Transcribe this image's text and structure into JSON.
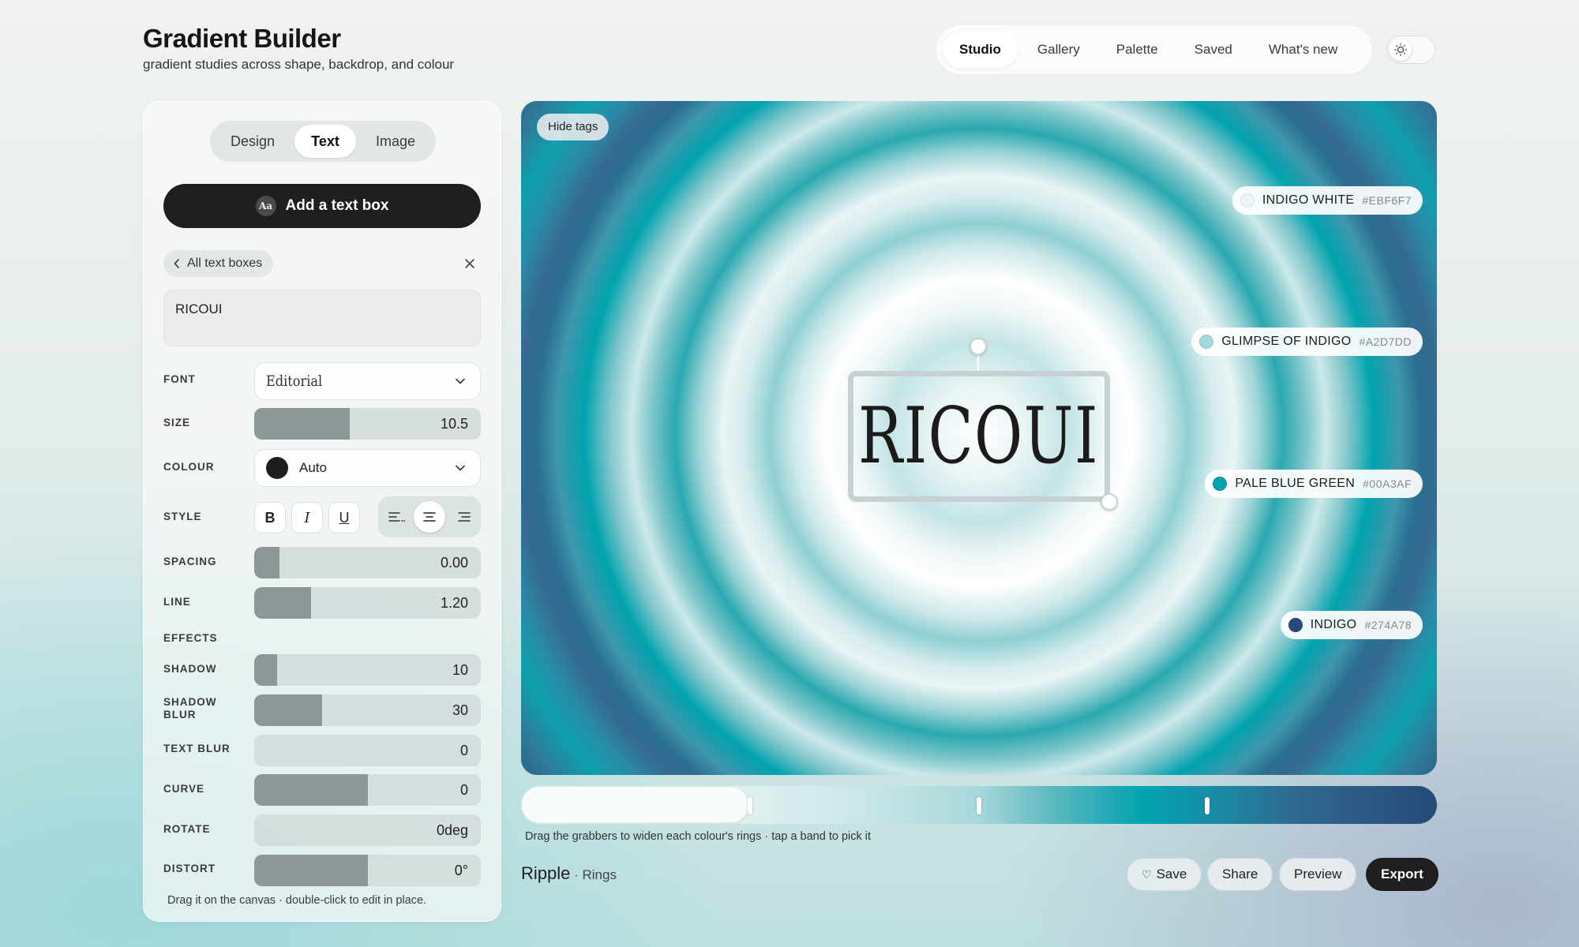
{
  "app": {
    "title": "Gradient Builder",
    "subtitle": "gradient studies across shape, backdrop, and colour"
  },
  "nav": {
    "tabs": [
      "Studio",
      "Gallery",
      "Palette",
      "Saved",
      "What's new"
    ],
    "active": "Studio"
  },
  "panel": {
    "tabs": [
      "Design",
      "Text",
      "Image"
    ],
    "active_tab": "Text",
    "add_button": "Add a text box",
    "add_icon_text": "Aa",
    "back_label": "All text boxes",
    "text_value": "RICOUI",
    "labels": {
      "font": "FONT",
      "size": "SIZE",
      "colour": "COLOUR",
      "style": "STYLE",
      "spacing": "SPACING",
      "line": "LINE",
      "effects": "EFFECTS",
      "shadow": "SHADOW",
      "shadow_blur": "SHADOW BLUR",
      "text_blur": "TEXT BLUR",
      "curve": "CURVE",
      "rotate": "ROTATE",
      "distort": "DISTORT"
    },
    "font_value": "Editorial",
    "colour_value": "Auto",
    "colour_swatch": "#1e1e1e",
    "style_buttons": {
      "bold": "B",
      "italic": "I",
      "underline": "U"
    },
    "alignment": "center",
    "sliders": {
      "size": {
        "value": "10.5",
        "fraction": 0.42
      },
      "spacing": {
        "value": "0.00",
        "fraction": 0.11
      },
      "line": {
        "value": "1.20",
        "fraction": 0.25
      },
      "shadow": {
        "value": "10",
        "fraction": 0.1
      },
      "shadow_blur": {
        "value": "30",
        "fraction": 0.3
      },
      "text_blur": {
        "value": "0",
        "fraction": 0.0
      },
      "curve": {
        "value": "0",
        "fraction": 0.5
      },
      "rotate": {
        "value": "0deg",
        "fraction": 0.0
      },
      "distort": {
        "value": "0°",
        "fraction": 0.5
      }
    },
    "footer": "Drag it on the canvas · double-click to edit in place."
  },
  "canvas": {
    "hide_tags": "Hide tags",
    "text": "RICOUI",
    "colors": [
      {
        "name": "INDIGO WHITE",
        "hex": "#EBF6F7"
      },
      {
        "name": "GLIMPSE OF INDIGO",
        "hex": "#A2D7DD"
      },
      {
        "name": "PALE BLUE GREEN",
        "hex": "#00A3AF"
      },
      {
        "name": "INDIGO",
        "hex": "#274A78"
      }
    ]
  },
  "strip": {
    "hint": "Drag the grabbers to widen each colour's rings · tap a band to pick it"
  },
  "preset": {
    "name": "Ripple",
    "separator": " · ",
    "sub": "Rings"
  },
  "actions": {
    "save": "Save",
    "save_icon": "♡",
    "share": "Share",
    "preview": "Preview",
    "export": "Export"
  }
}
